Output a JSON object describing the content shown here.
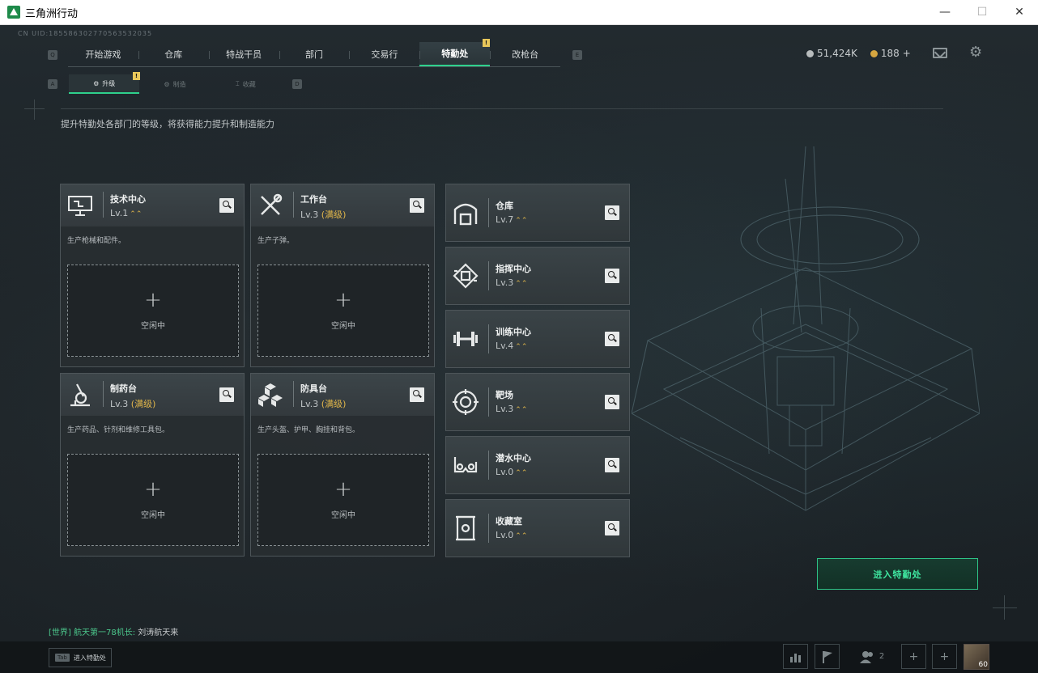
{
  "window": {
    "title": "三角洲行动",
    "minimize": "—",
    "maximize": "☐",
    "close": "✕"
  },
  "uid": "CN UID:185586302770563532035",
  "main_tabs": [
    {
      "label": "开始游戏"
    },
    {
      "label": "仓库"
    },
    {
      "label": "特战干员"
    },
    {
      "label": "部门"
    },
    {
      "label": "交易行"
    },
    {
      "label": "特勤处",
      "active": true
    },
    {
      "label": "改枪台"
    }
  ],
  "keyhints": {
    "main_left": "Q",
    "main_right": "E",
    "sub_left": "A",
    "sub_right": "D"
  },
  "badge": "!",
  "currency": {
    "coins": "51,424K",
    "tickets": "188",
    "add": "+",
    "coin_color": "#b8bcbd",
    "ticket_color": "#d6a640"
  },
  "sub_tabs": [
    {
      "label": "升级",
      "icon": "⚙",
      "active": true
    },
    {
      "label": "制造",
      "icon": "⚙"
    },
    {
      "label": "收藏",
      "icon": "⌶"
    }
  ],
  "description": "提升特勤处各部门的等级，将获得能力提升和制造能力",
  "work_cards": [
    {
      "name": "技术中心",
      "level": "Lv.1",
      "max": "",
      "up": "⌃⌃",
      "desc": "生产枪械和配件。",
      "slot_plus": "+",
      "slot_label": "空闲中",
      "icon": "computer-icon"
    },
    {
      "name": "工作台",
      "level": "Lv.3",
      "max": "(满级)",
      "up": "",
      "desc": "生产子弹。",
      "slot_plus": "+",
      "slot_label": "空闲中",
      "icon": "tools-icon"
    },
    {
      "name": "制药台",
      "level": "Lv.3",
      "max": "(满级)",
      "up": "",
      "desc": "生产药品、针剂和维修工具包。",
      "slot_plus": "+",
      "slot_label": "空闲中",
      "icon": "microscope-icon"
    },
    {
      "name": "防具台",
      "level": "Lv.3",
      "max": "(满级)",
      "up": "",
      "desc": "生产头盔、护甲、胸挂和背包。",
      "slot_plus": "+",
      "slot_label": "空闲中",
      "icon": "cubes-icon"
    }
  ],
  "dept_cards": [
    {
      "name": "仓库",
      "level": "Lv.7",
      "up": "⌃⌃",
      "icon": "warehouse-icon"
    },
    {
      "name": "指挥中心",
      "level": "Lv.3",
      "up": "⌃⌃",
      "icon": "command-icon"
    },
    {
      "name": "训练中心",
      "level": "Lv.4",
      "up": "⌃⌃",
      "icon": "dumbbell-icon"
    },
    {
      "name": "靶场",
      "level": "Lv.3",
      "up": "⌃⌃",
      "icon": "target-icon"
    },
    {
      "name": "潜水中心",
      "level": "Lv.0",
      "up": "⌃⌃",
      "icon": "goggles-icon"
    },
    {
      "name": "收藏室",
      "level": "Lv.0",
      "up": "⌃⌃",
      "icon": "vault-icon"
    }
  ],
  "enter_button": "进入特勤处",
  "chat": {
    "channel": "[世界]",
    "sender": "航天第一78机长:",
    "message": "刘涛航天来"
  },
  "bottom": {
    "tab_key": "Tab",
    "tab_label": "进入特勤处",
    "friends_count": "2",
    "add": "+",
    "avatar_level": "60"
  }
}
